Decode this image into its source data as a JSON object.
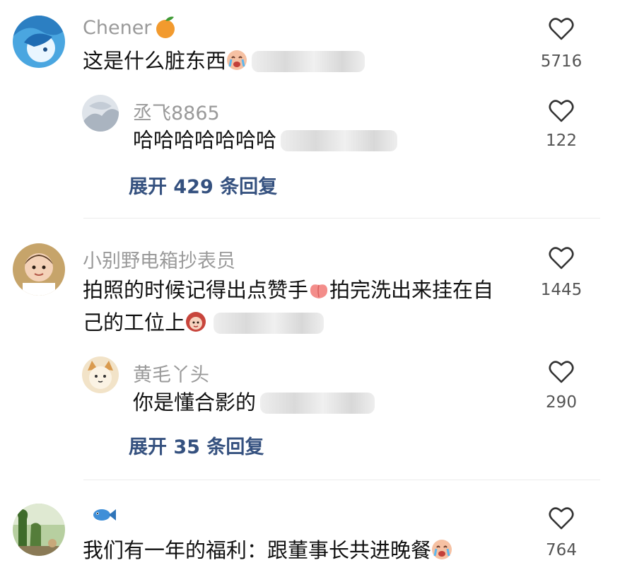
{
  "colors": {
    "username": "#9a9a9a",
    "content": "#111111",
    "expand_link": "#35517f",
    "like_count": "#555555"
  },
  "comments": [
    {
      "username": "Chener",
      "username_badge": "orange-emoji",
      "text": "这是什么脏东西",
      "trailing_emoji": "crying-face-emoji",
      "likes": "5716",
      "replies": [
        {
          "username": "丞飞8865",
          "text": "哈哈哈哈哈哈哈",
          "likes": "122"
        }
      ],
      "expand_label": "展开 429 条回复"
    },
    {
      "username": "小别野电箱抄表员",
      "text_line1_a": "拍照的时候记得出点赞手",
      "inline_emoji": "peach-emoji",
      "text_line1_b": "拍完洗出来挂在自",
      "text_line2": "己的工位上",
      "trailing_emoji": "girl-emoji",
      "likes": "1445",
      "replies": [
        {
          "username": "黄毛丫头",
          "text": "你是懂合影的",
          "likes": "290"
        }
      ],
      "expand_label": "展开 35 条回复"
    },
    {
      "username_badge": "fish-emoji",
      "text": "我们有一年的福利：跟董事长共进晚餐",
      "trailing_emoji": "crying-face-emoji",
      "likes": "764"
    }
  ]
}
